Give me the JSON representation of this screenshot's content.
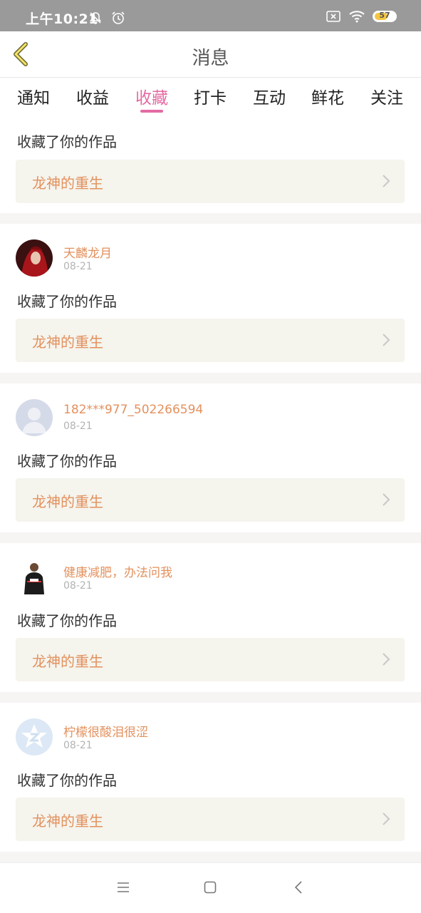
{
  "status_bar": {
    "time": "上午10:21",
    "battery_level": "57",
    "icons": [
      "bell-off-icon",
      "alarm-icon",
      "sim-x-icon",
      "wifi-icon",
      "battery-icon"
    ]
  },
  "header": {
    "title": "消息",
    "back_icon": "chevron-left-icon"
  },
  "tabs": [
    {
      "label": "通知",
      "active": false
    },
    {
      "label": "收益",
      "active": false
    },
    {
      "label": "收藏",
      "active": true
    },
    {
      "label": "打卡",
      "active": false
    },
    {
      "label": "互动",
      "active": false
    },
    {
      "label": "鲜花",
      "active": false
    },
    {
      "label": "关注",
      "active": false
    }
  ],
  "messages": [
    {
      "action": "收藏了你的作品",
      "work_title": "龙神的重生"
    },
    {
      "username": "天麟龙月",
      "date": "08-21",
      "action": "收藏了你的作品",
      "work_title": "龙神的重生"
    },
    {
      "username": "182***977_502266594",
      "date": "08-21",
      "action": "收藏了你的作品",
      "work_title": "龙神的重生"
    },
    {
      "username": "健康减肥，办法问我",
      "date": "08-21",
      "action": "收藏了你的作品",
      "work_title": "龙神的重生"
    },
    {
      "username": "柠檬很酸泪很涩",
      "date": "08-21",
      "action": "收藏了你的作品",
      "work_title": "龙神的重生"
    }
  ],
  "bottom_nav": {
    "icons": [
      "menu-icon",
      "home-square-icon",
      "back-arrow-icon"
    ]
  },
  "colors": {
    "accent_pink": "#e46ba3",
    "username_orange": "#e3915e",
    "work_box_bg": "#f5f4ed",
    "separator": "#f7f4f4"
  }
}
